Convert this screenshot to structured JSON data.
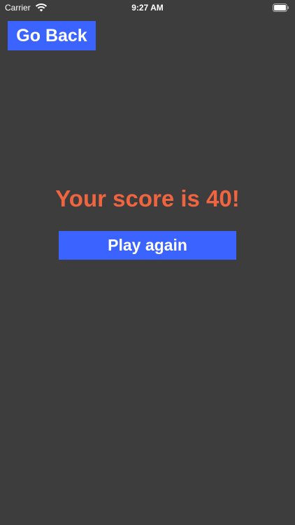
{
  "status_bar": {
    "carrier": "Carrier",
    "time": "9:27 AM",
    "wifi_icon": "wifi-icon",
    "battery_icon": "battery-icon"
  },
  "nav": {
    "go_back_label": "Go Back"
  },
  "result": {
    "score_text": "Your score is 40!"
  },
  "actions": {
    "play_again_label": "Play again"
  },
  "colors": {
    "background": "#3d3d3d",
    "button": "#3a63ff",
    "score": "#f0653f",
    "text": "#ffffff"
  }
}
